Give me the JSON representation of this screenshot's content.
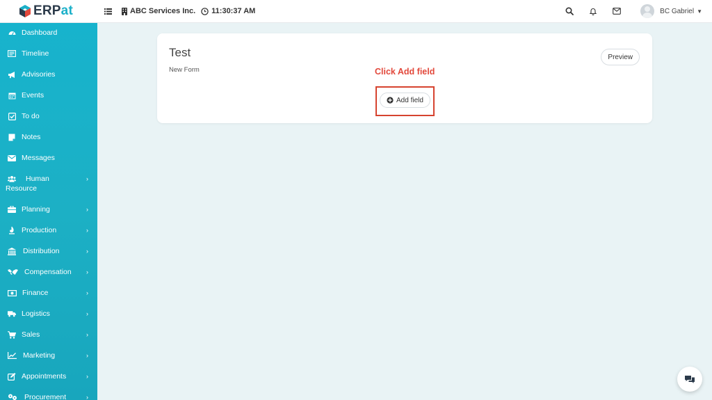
{
  "brand": {
    "part1": "ERP",
    "part2": "at",
    "accent": "#1bb0c9",
    "dark": "#2b3a4a"
  },
  "topbar": {
    "menu_icon": "hamburger-icon",
    "company": "ABC Services Inc.",
    "time": "11:30:37 AM",
    "icons": [
      "search-icon",
      "bell-icon",
      "mail-icon"
    ],
    "user_name": "BC Gabriel"
  },
  "sidebar": {
    "items": [
      {
        "label": "Dashboard",
        "icon": "dashboard-icon",
        "has_children": false
      },
      {
        "label": "Timeline",
        "icon": "timeline-icon",
        "has_children": false
      },
      {
        "label": "Advisories",
        "icon": "megaphone-icon",
        "has_children": false
      },
      {
        "label": "Events",
        "icon": "calendar-icon",
        "has_children": false
      },
      {
        "label": "To do",
        "icon": "check-square-icon",
        "has_children": false
      },
      {
        "label": "Notes",
        "icon": "note-icon",
        "has_children": false
      },
      {
        "label": "Messages",
        "icon": "envelope-icon",
        "has_children": false
      },
      {
        "label_line1": "Human",
        "label_line2": "Resource",
        "icon": "users-icon",
        "has_children": true
      },
      {
        "label": "Planning",
        "icon": "briefcase-icon",
        "has_children": true
      },
      {
        "label": "Production",
        "icon": "flame-icon",
        "has_children": true
      },
      {
        "label": "Distribution",
        "icon": "bank-icon",
        "has_children": true
      },
      {
        "label": "Compensation",
        "icon": "handshake-icon",
        "has_children": true
      },
      {
        "label": "Finance",
        "icon": "money-icon",
        "has_children": true
      },
      {
        "label": "Logistics",
        "icon": "truck-icon",
        "has_children": true
      },
      {
        "label": "Sales",
        "icon": "cart-icon",
        "has_children": true
      },
      {
        "label": "Marketing",
        "icon": "line-chart-icon",
        "has_children": true
      },
      {
        "label": "Appointments",
        "icon": "edit-icon",
        "has_children": true
      },
      {
        "label": "Procurement",
        "icon": "procurement-icon",
        "has_children": true
      }
    ]
  },
  "form": {
    "title": "Test",
    "subtitle": "New Form",
    "preview_label": "Preview",
    "add_field_label": "Add field"
  },
  "annotation": {
    "text": "Click Add field",
    "color": "#e2483b"
  },
  "chat": {
    "icon": "chat-icon"
  }
}
